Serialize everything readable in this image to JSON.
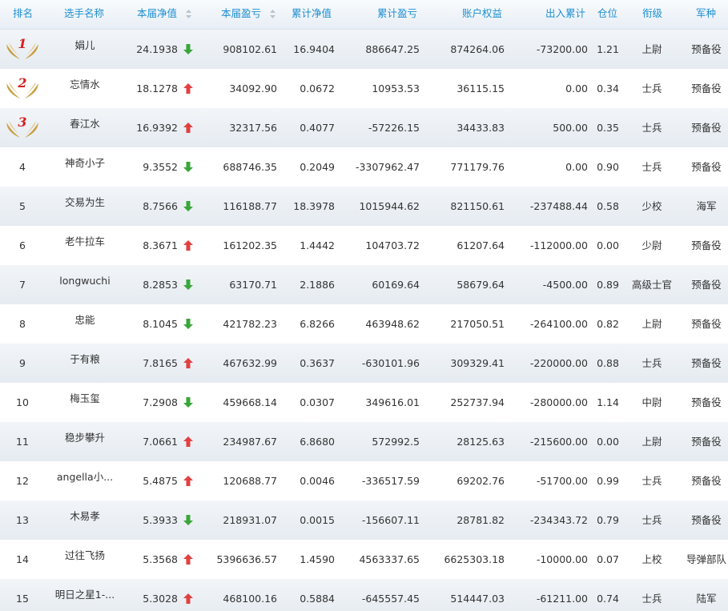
{
  "headers": {
    "rank": "排名",
    "name": "选手名称",
    "nav": "本届净值",
    "pnl": "本届盈亏",
    "cum_nav": "累计净值",
    "cum_pnl": "累计盈亏",
    "equity": "账户权益",
    "flow": "出入累计",
    "position": "仓位",
    "title": "衔级",
    "branch": "军种"
  },
  "colors": {
    "header_text": "#1e8fd2",
    "up_arrow": "#e24040",
    "down_arrow": "#3aa63a",
    "medal_gold": "#c9a043",
    "medal_numeral": "#d62020"
  },
  "icons": {
    "sort": "sort-updown-icon",
    "up": "red-up-arrow-icon",
    "down": "green-down-arrow-icon",
    "medal": "golden-wings-medal-icon"
  },
  "rows": [
    {
      "rank": "1",
      "name": "娟儿",
      "nav": "24.1938",
      "trend": "down",
      "pnl": "908102.61",
      "cum_nav": "16.9404",
      "cum_pnl": "886647.25",
      "equity": "874264.06",
      "flow": "-73200.00",
      "position": "1.21",
      "title": "上尉",
      "branch": "预备役"
    },
    {
      "rank": "2",
      "name": "忘情水",
      "nav": "18.1278",
      "trend": "up",
      "pnl": "34092.90",
      "cum_nav": "0.0672",
      "cum_pnl": "10953.53",
      "equity": "36115.15",
      "flow": "0.00",
      "position": "0.34",
      "title": "士兵",
      "branch": "预备役"
    },
    {
      "rank": "3",
      "name": "春江水",
      "nav": "16.9392",
      "trend": "up",
      "pnl": "32317.56",
      "cum_nav": "0.4077",
      "cum_pnl": "-57226.15",
      "equity": "34433.83",
      "flow": "500.00",
      "position": "0.35",
      "title": "士兵",
      "branch": "预备役"
    },
    {
      "rank": "4",
      "name": "神奇小子",
      "nav": "9.3552",
      "trend": "down",
      "pnl": "688746.35",
      "cum_nav": "0.2049",
      "cum_pnl": "-3307962.47",
      "equity": "771179.76",
      "flow": "0.00",
      "position": "0.90",
      "title": "士兵",
      "branch": "预备役"
    },
    {
      "rank": "5",
      "name": "交易为生",
      "nav": "8.7566",
      "trend": "down",
      "pnl": "116188.77",
      "cum_nav": "18.3978",
      "cum_pnl": "1015944.62",
      "equity": "821150.61",
      "flow": "-237488.44",
      "position": "0.58",
      "title": "少校",
      "branch": "海军"
    },
    {
      "rank": "6",
      "name": "老牛拉车",
      "nav": "8.3671",
      "trend": "up",
      "pnl": "161202.35",
      "cum_nav": "1.4442",
      "cum_pnl": "104703.72",
      "equity": "61207.64",
      "flow": "-112000.00",
      "position": "0.00",
      "title": "少尉",
      "branch": "预备役"
    },
    {
      "rank": "7",
      "name": "longwuchi",
      "nav": "8.2853",
      "trend": "down",
      "pnl": "63170.71",
      "cum_nav": "2.1886",
      "cum_pnl": "60169.64",
      "equity": "58679.64",
      "flow": "-4500.00",
      "position": "0.89",
      "title": "高级士官",
      "branch": "预备役"
    },
    {
      "rank": "8",
      "name": "忠能",
      "nav": "8.1045",
      "trend": "down",
      "pnl": "421782.23",
      "cum_nav": "6.8266",
      "cum_pnl": "463948.62",
      "equity": "217050.51",
      "flow": "-264100.00",
      "position": "0.82",
      "title": "上尉",
      "branch": "预备役"
    },
    {
      "rank": "9",
      "name": "于有粮",
      "nav": "7.8165",
      "trend": "up",
      "pnl": "467632.99",
      "cum_nav": "0.3637",
      "cum_pnl": "-630101.96",
      "equity": "309329.41",
      "flow": "-220000.00",
      "position": "0.88",
      "title": "士兵",
      "branch": "预备役"
    },
    {
      "rank": "10",
      "name": "梅玉玺",
      "nav": "7.2908",
      "trend": "down",
      "pnl": "459668.14",
      "cum_nav": "0.0307",
      "cum_pnl": "349616.01",
      "equity": "252737.94",
      "flow": "-280000.00",
      "position": "1.14",
      "title": "中尉",
      "branch": "预备役"
    },
    {
      "rank": "11",
      "name": "稳步攀升",
      "nav": "7.0661",
      "trend": "up",
      "pnl": "234987.67",
      "cum_nav": "6.8680",
      "cum_pnl": "572992.5",
      "equity": "28125.63",
      "flow": "-215600.00",
      "position": "0.00",
      "title": "上尉",
      "branch": "预备役"
    },
    {
      "rank": "12",
      "name": "angella小...",
      "nav": "5.4875",
      "trend": "up",
      "pnl": "120688.77",
      "cum_nav": "0.0046",
      "cum_pnl": "-336517.59",
      "equity": "69202.76",
      "flow": "-51700.00",
      "position": "0.99",
      "title": "士兵",
      "branch": "预备役"
    },
    {
      "rank": "13",
      "name": "木易孝",
      "nav": "5.3933",
      "trend": "down",
      "pnl": "218931.07",
      "cum_nav": "0.0015",
      "cum_pnl": "-156607.11",
      "equity": "28781.82",
      "flow": "-234343.72",
      "position": "0.79",
      "title": "士兵",
      "branch": "预备役"
    },
    {
      "rank": "14",
      "name": "过往飞扬",
      "nav": "5.3568",
      "trend": "up",
      "pnl": "5396636.57",
      "cum_nav": "1.4590",
      "cum_pnl": "4563337.65",
      "equity": "6625303.18",
      "flow": "-10000.00",
      "position": "0.07",
      "title": "上校",
      "branch": "导弹部队"
    },
    {
      "rank": "15",
      "name": "明日之星1-...",
      "nav": "5.3028",
      "trend": "up",
      "pnl": "468100.16",
      "cum_nav": "0.5884",
      "cum_pnl": "-645557.45",
      "equity": "514447.03",
      "flow": "-61211.00",
      "position": "0.74",
      "title": "士兵",
      "branch": "陆军"
    }
  ]
}
